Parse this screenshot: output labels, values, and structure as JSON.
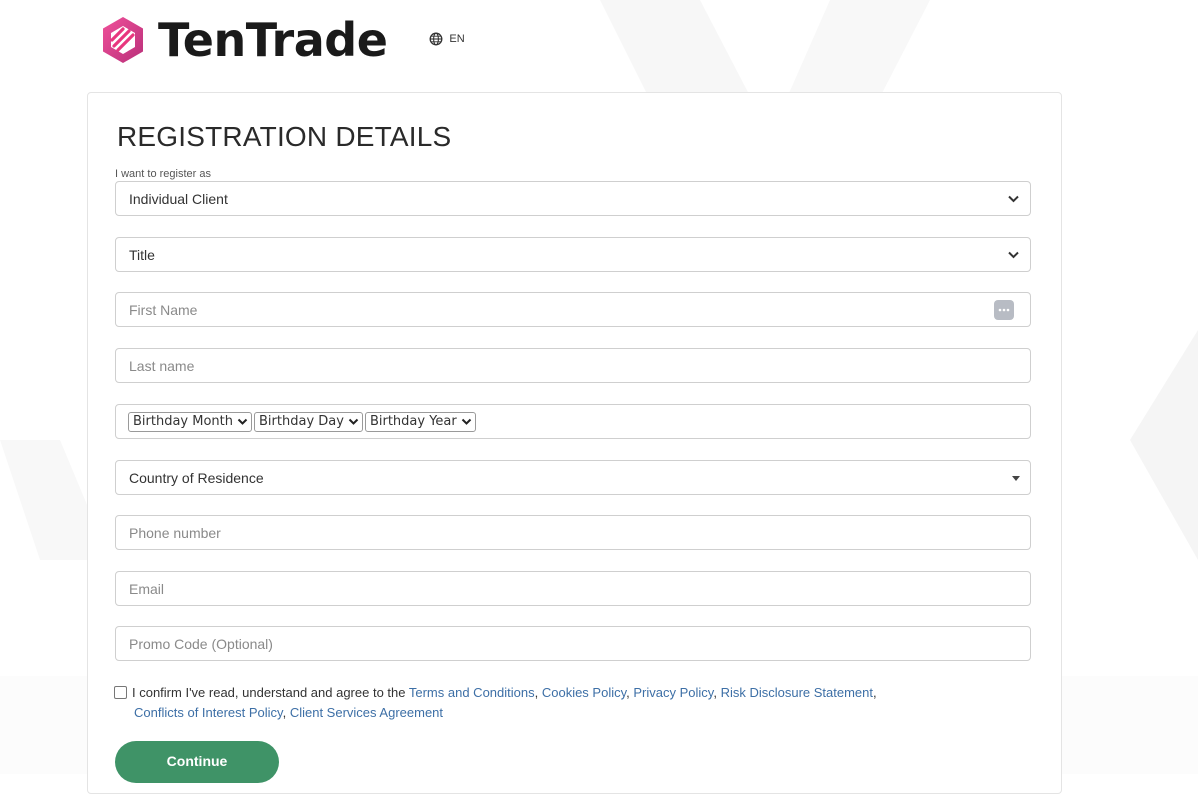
{
  "brand": {
    "name": "TenTrade",
    "accent": "#e8377e"
  },
  "language": {
    "code": "EN",
    "icon": "globe-icon"
  },
  "form": {
    "title": "REGISTRATION DETAILS",
    "register_as_label": "I want to register as",
    "register_as_value": "Individual Client",
    "title_select": "Title",
    "first_name_placeholder": "First Name",
    "last_name_placeholder": "Last name",
    "birthday": {
      "month": "Birthday Month",
      "day": "Birthday Day",
      "year": "Birthday Year"
    },
    "country_placeholder": "Country of Residence",
    "phone_placeholder": "Phone number",
    "email_placeholder": "Email",
    "promo_placeholder": "Promo Code (Optional)",
    "terms": {
      "prefix": "I confirm I've read, understand and agree to the",
      "links": [
        "Terms and Conditions",
        "Cookies Policy",
        "Privacy Policy",
        "Risk Disclosure Statement",
        "Conflicts of Interest Policy",
        "Client Services Agreement"
      ],
      "link_color": "#3d6fa6"
    },
    "continue_label": "Continue",
    "continue_color": "#3f9367"
  }
}
